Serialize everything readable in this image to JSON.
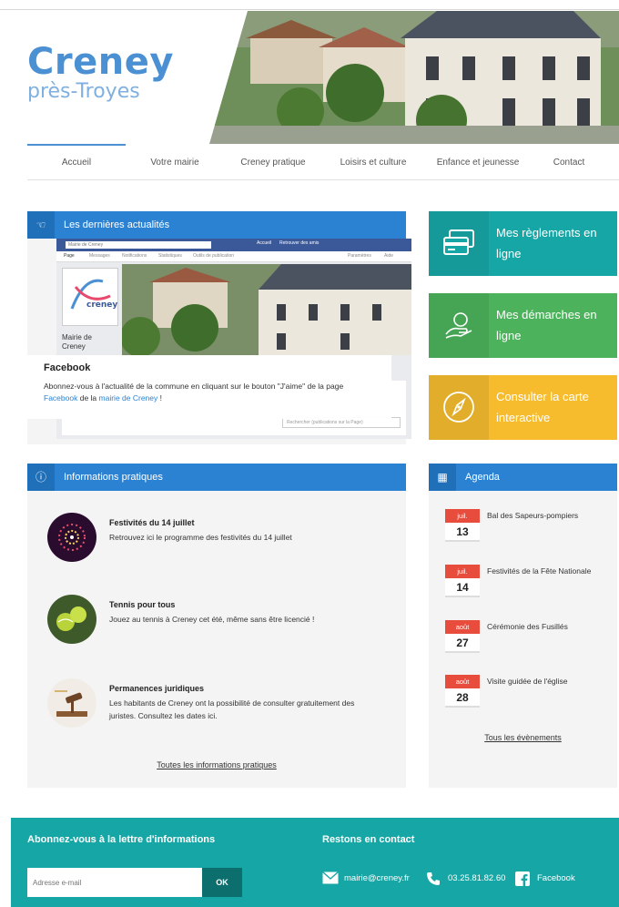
{
  "site": {
    "name": "Creney",
    "subtitle": "près-Troyes"
  },
  "nav": {
    "items": [
      "Accueil",
      "Votre mairie",
      "Creney pratique",
      "Loisirs et culture",
      "Enfance et jeunesse",
      "Contact"
    ],
    "active": "Accueil",
    "accent_color": "#4a90d2"
  },
  "news": {
    "heading": "Les dernières actualités",
    "icon": "thumbs-up-icon",
    "fb": {
      "search_placeholder": "Mairie de Creney",
      "bar_links": [
        "Accueil",
        "Retrouver des amis"
      ],
      "tabs": [
        "Page",
        "Messages",
        "Notifications",
        "Statistiques",
        "Outils de publication"
      ],
      "tabs_right": [
        "Paramètres",
        "Aide"
      ],
      "page_name": "Mairie de Creney",
      "logo_text": "creney",
      "comment_placeholder": "Rechercher (publications sur la Page)"
    },
    "post": {
      "title": "Facebook",
      "text_before": "Abonnez-vous à l'actualité de la commune en cliquant sur le bouton \"J'aime\" de la page",
      "link1": "Facebook",
      "text_mid": "de la",
      "link2": "mairie de Creney",
      "text_after": "!"
    }
  },
  "tiles": [
    {
      "label": "Mes règlements en ligne",
      "color": "#17a6a6",
      "icon": "credit-card-icon"
    },
    {
      "label": "Mes démarches en ligne",
      "color": "#4cb35c",
      "icon": "hand-icon"
    },
    {
      "label": "Consulter la carte interactive",
      "color": "#f6bc2e",
      "icon": "compass-icon"
    }
  ],
  "info": {
    "heading": "Informations pratiques",
    "icon": "info-icon",
    "items": [
      {
        "title": "Festivités du 14 juillet",
        "desc": "Retrouvez ici le programme des festivités du 14 juillet"
      },
      {
        "title": "Tennis pour tous",
        "desc": "Jouez au tennis à Creney cet été, même sans être licencié !"
      },
      {
        "title": "Permanences juridiques",
        "desc": "Les habitants de Creney ont la possibilité de consulter gratuitement des juristes. Consultez les dates ici."
      }
    ],
    "all_link": "Toutes les informations pratiques"
  },
  "agenda": {
    "heading": "Agenda",
    "icon": "calendar-icon",
    "events": [
      {
        "month": "juil.",
        "day": "13",
        "title": "Bal des Sapeurs-pompiers"
      },
      {
        "month": "juil.",
        "day": "14",
        "title": "Festivités de la Fête Nationale"
      },
      {
        "month": "août",
        "day": "27",
        "title": "Cérémonie des Fusillés"
      },
      {
        "month": "août",
        "day": "28",
        "title": "Visite guidée de l'église"
      }
    ],
    "all_link": "Tous les évènements"
  },
  "footer": {
    "newsletter_title": "Abonnez-vous à la lettre d'informations",
    "email_placeholder": "Adresse e-mail",
    "ok_label": "OK",
    "contact_title": "Restons en contact",
    "email": "mairie@creney.fr",
    "phone": "03.25.81.82.60",
    "facebook": "Facebook",
    "color": "#17a6a6"
  }
}
